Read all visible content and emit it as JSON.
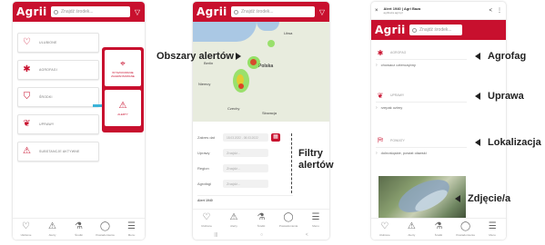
{
  "app": {
    "logo": "Agrii",
    "search_placeholder": "Znajdź środek..."
  },
  "screen1": {
    "cards": [
      {
        "icon": "heart-icon",
        "glyph": "♡",
        "label": "ULUBIONE"
      },
      {
        "icon": "bug-icon",
        "glyph": "✱",
        "label": "AGROFAGI"
      },
      {
        "icon": "bottle-icon",
        "glyph": "⛉",
        "label": "ŚRODKI"
      },
      {
        "icon": "plant-icon",
        "glyph": "❦",
        "label": "UPRAWY"
      },
      {
        "icon": "warning-icon",
        "glyph": "⚠",
        "label": "SUBSTANCJE AKTYWNE"
      }
    ],
    "popup": [
      {
        "icon": "map-pin-icon",
        "glyph": "⌖",
        "label": "WYSZUKIWANIE ZAAWANSOWANE"
      },
      {
        "icon": "alert-icon",
        "glyph": "⚠",
        "label": "ALERTY"
      }
    ]
  },
  "nav": [
    {
      "icon": "heart-icon",
      "glyph": "♡",
      "label": "Ulubione"
    },
    {
      "icon": "alert-icon",
      "glyph": "⚠",
      "label": "Alerty"
    },
    {
      "icon": "bottle-icon",
      "glyph": "⚗",
      "label": "Środki"
    },
    {
      "icon": "bell-icon",
      "glyph": "🔔",
      "label": "Powiadomienia"
    },
    {
      "icon": "menu-icon",
      "glyph": "☰",
      "label": "Menu"
    }
  ],
  "screen2": {
    "map_cities": [
      "Litwa",
      "Polska",
      "Berlin",
      "Niemcy",
      "Czechy",
      "Słowacja"
    ],
    "filters": [
      {
        "label": "Zakres dat",
        "value": "18.03.2022 - 08.03.2022"
      },
      {
        "label": "Uprawy",
        "value": "Znajdź..."
      },
      {
        "label": "Region",
        "value": "Znajdź..."
      },
      {
        "label": "Agrofagi",
        "value": "Znajdź..."
      }
    ],
    "list_header": "Alert 1940"
  },
  "screen3": {
    "top_title": "Alert 1940 | Agri Baza",
    "top_url": "agribaza.agrii.pl",
    "sections": [
      {
        "icon": "bug-icon",
        "glyph": "✱",
        "head": "AGROFAG",
        "body": "chowacz czterozębny"
      },
      {
        "icon": "plant-icon",
        "glyph": "❦",
        "head": "UPRAWY",
        "body": "rzepak ozimy"
      },
      {
        "icon": "map-icon",
        "glyph": "⛿",
        "head": "POWIATY",
        "body": "dolnośląskie, powiat oławski"
      }
    ]
  },
  "annotations": {
    "areas": "Obszary alertów",
    "filters_line1": "Filtry",
    "filters_line2": "alertów",
    "agrofag": "Agrofag",
    "uprawa": "Uprawa",
    "lokalizacja": "Lokalizacja",
    "photo": "Zdjęcie/a"
  }
}
